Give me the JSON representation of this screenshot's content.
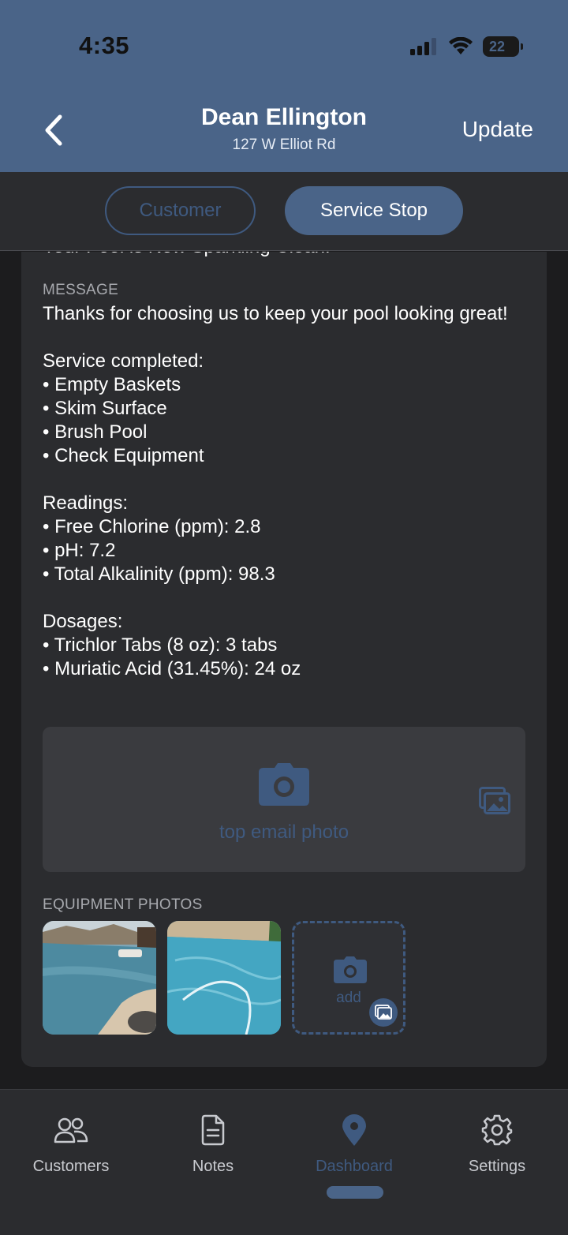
{
  "status_bar": {
    "time": "4:35",
    "battery": "22"
  },
  "header": {
    "title": "Dean Ellington",
    "subtitle": "127 W Elliot Rd",
    "update_label": "Update"
  },
  "tabs": {
    "customer": "Customer",
    "service_stop": "Service Stop",
    "active": "service_stop"
  },
  "email": {
    "subject": "Your Pool is Now Sparkling Clean!",
    "message_label": "MESSAGE",
    "message_body": "Thanks for choosing us to keep your pool looking great!\n\nService completed:\n• Empty Baskets\n• Skim Surface\n• Brush Pool\n• Check Equipment\n\nReadings:\n• Free Chlorine (ppm): 2.8\n• pH: 7.2\n• Total Alkalinity (ppm): 98.3\n\nDosages:\n• Trichlor Tabs (8 oz): 3 tabs\n• Muriatic Acid (31.45%): 24 oz",
    "top_photo_label": "top email photo"
  },
  "equipment_photos": {
    "label": "EQUIPMENT PHOTOS",
    "add_label": "add"
  },
  "bottom_nav": {
    "items": [
      {
        "label": "Customers",
        "icon": "customers-icon"
      },
      {
        "label": "Notes",
        "icon": "notes-icon"
      },
      {
        "label": "Dashboard",
        "icon": "map-pin-icon"
      },
      {
        "label": "Settings",
        "icon": "gear-icon"
      }
    ],
    "active": "Dashboard"
  },
  "colors": {
    "accent": "#4a6488",
    "accent_dim": "#3f5a80",
    "surface": "#2b2c2f",
    "background": "#1c1c1e"
  }
}
